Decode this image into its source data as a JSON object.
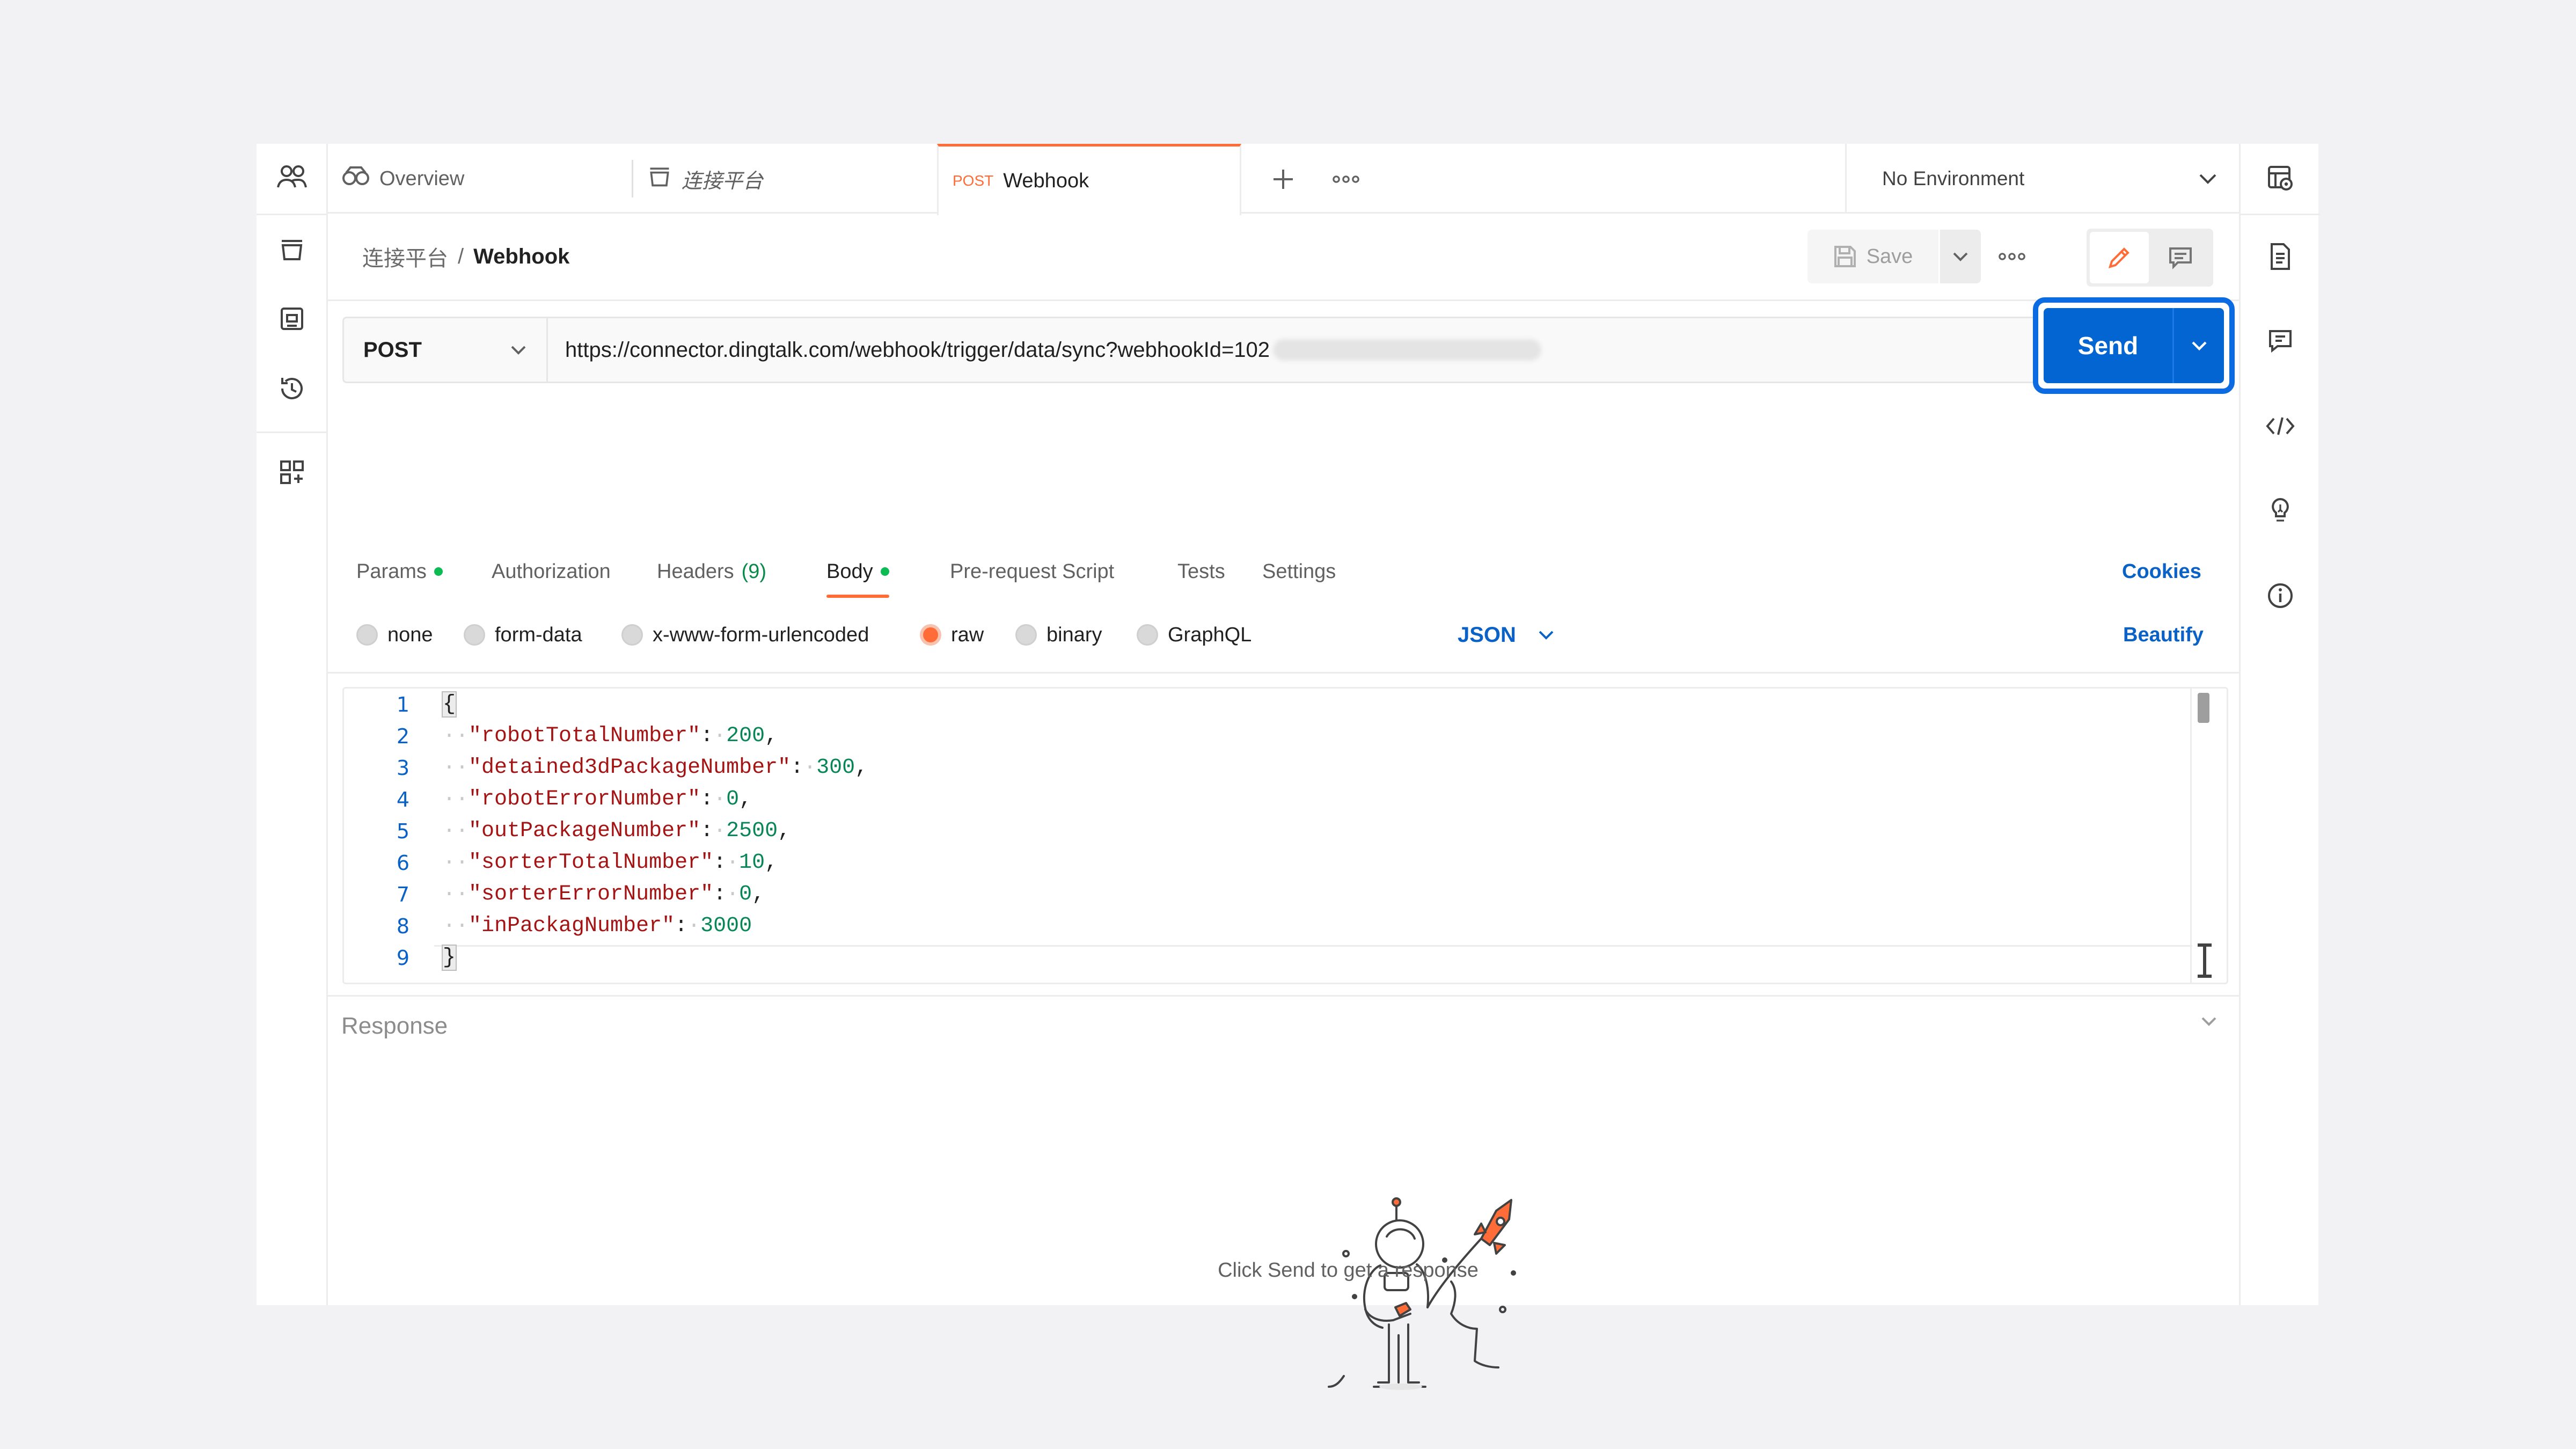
{
  "tabs": [
    {
      "label": "Overview",
      "icon": "overview-icon"
    },
    {
      "label": "连接平台",
      "icon": "collection-icon"
    },
    {
      "method": "POST",
      "label": "Webhook",
      "active": true
    }
  ],
  "environment": {
    "selected": "No Environment"
  },
  "breadcrumb": {
    "parent": "连接平台",
    "separator": "/",
    "current": "Webhook"
  },
  "toolbar": {
    "save_label": "Save"
  },
  "request": {
    "method": "POST",
    "url": "https://connector.dingtalk.com/webhook/trigger/data/sync?webhookId=102",
    "send_label": "Send"
  },
  "request_tabs": {
    "params": "Params",
    "authorization": "Authorization",
    "headers": "Headers",
    "headers_count": "(9)",
    "body": "Body",
    "pre_request": "Pre-request Script",
    "tests": "Tests",
    "settings": "Settings",
    "cookies": "Cookies"
  },
  "body_options": {
    "none": "none",
    "form_data": "form-data",
    "urlencoded": "x-www-form-urlencoded",
    "raw": "raw",
    "binary": "binary",
    "graphql": "GraphQL",
    "language": "JSON",
    "beautify": "Beautify",
    "selected": "raw"
  },
  "editor": {
    "line_numbers": [
      "1",
      "2",
      "3",
      "4",
      "5",
      "6",
      "7",
      "8",
      "9"
    ],
    "open_brace": "{",
    "close_brace": "}",
    "entries": [
      {
        "key": "\"robotTotalNumber\"",
        "value": "200",
        "trail": ","
      },
      {
        "key": "\"detained3dPackageNumber\"",
        "value": "300",
        "trail": ","
      },
      {
        "key": "\"robotErrorNumber\"",
        "value": "0",
        "trail": ","
      },
      {
        "key": "\"outPackageNumber\"",
        "value": "2500",
        "trail": ","
      },
      {
        "key": "\"sorterTotalNumber\"",
        "value": "10",
        "trail": ","
      },
      {
        "key": "\"sorterErrorNumber\"",
        "value": "0",
        "trail": ","
      },
      {
        "key": "\"inPackagNumber\"",
        "value": "3000",
        "trail": ""
      }
    ]
  },
  "response": {
    "title": "Response",
    "empty_hint": "Click Send to get a response"
  },
  "colors": {
    "accent_orange": "#ff6c37",
    "send_blue": "#0265d2",
    "highlight_blue": "#0c6be0",
    "link_blue": "#0b62c6",
    "status_green": "#0cbb52"
  }
}
